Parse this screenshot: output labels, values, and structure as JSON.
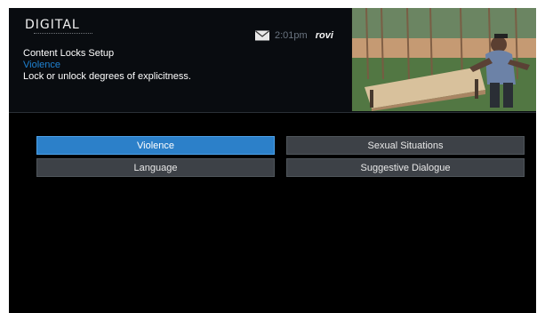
{
  "header": {
    "logo": "DIGITAL",
    "time": "2:01pm",
    "brand": "rovi"
  },
  "info": {
    "title": "Content Locks Setup",
    "selected_category": "Violence",
    "description": "Lock or unlock degrees of explicitness."
  },
  "buttons": [
    {
      "label": "Violence"
    },
    {
      "label": "Sexual Situations"
    },
    {
      "label": "Language"
    },
    {
      "label": "Suggestive Dialogue"
    }
  ],
  "colors": {
    "highlight": "#2c80c9",
    "button": "#3d4147",
    "background": "#000000"
  },
  "icons": [
    "mail-icon"
  ]
}
